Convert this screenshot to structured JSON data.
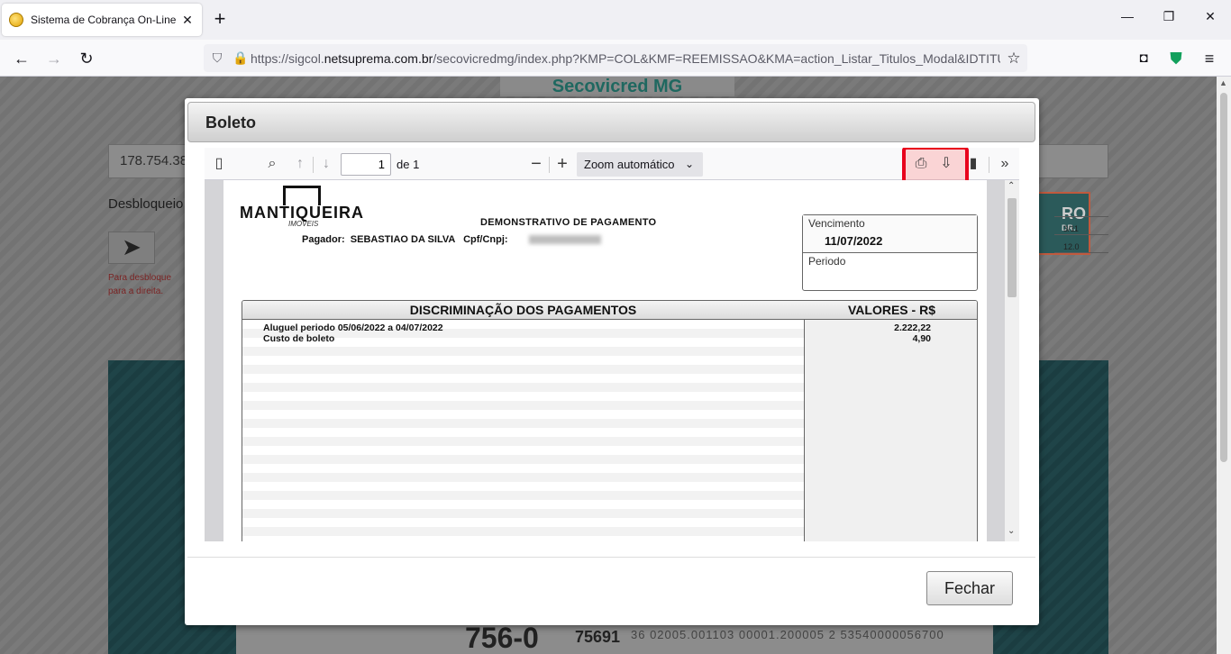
{
  "browser": {
    "tab_title": "Sistema de Cobrança On-Line (",
    "url_prefix": "https://sigcol.",
    "url_domain": "netsuprema.com.br",
    "url_path": "/secovicredmg/index.php?KMP=COL&KMF=REEMISSAO&KMA=action_Listar_Titulos_Modal&IDTITUL"
  },
  "background": {
    "header": "Secovicred MG",
    "input_value": "178.754.38",
    "label": "Desbloqueio",
    "hint_line1": "Para desbloque",
    "hint_line2": "para a direita.",
    "badge_big": "RO",
    "badge_small": "DR.",
    "grid_val1": "3/11",
    "grid_val2": "12.0",
    "boleto_code": "756-0",
    "boleto_bank": "75691",
    "boleto_line": "36 02005.001103 00001.200005 2 53540000056700"
  },
  "modal": {
    "title": "Boleto",
    "close_label": "Fechar"
  },
  "pdf_toolbar": {
    "page_number": "1",
    "page_count": "de 1",
    "zoom_label": "Zoom automático"
  },
  "document": {
    "logo_name": "MANTIQUEIRA",
    "logo_sub": "IMOVEIS",
    "title": "DEMONSTRATIVO DE PAGAMENTO",
    "pagador": "Pagador:  SEBASTIAO DA SILVA   Cpf/Cnpj:",
    "vencimento_label": "Vencimento",
    "vencimento_value": "11/07/2022",
    "periodo_label": "Periodo",
    "col_desc": "DISCRIMINAÇÃO DOS PAGAMENTOS",
    "col_values": "VALORES - R$",
    "rows": [
      {
        "desc": "Aluguel periodo 05/06/2022 a 04/07/2022",
        "value": "2.222,22"
      },
      {
        "desc": "Custo de boleto",
        "value": "4,90"
      }
    ]
  },
  "colors": {
    "highlight": "#e8001c",
    "brand_teal": "#1f6860"
  }
}
